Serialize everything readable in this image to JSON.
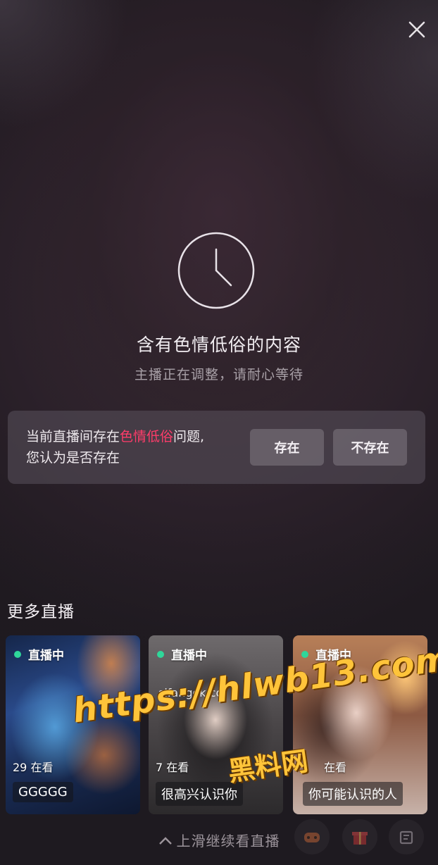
{
  "header": {
    "close_icon": "close-icon"
  },
  "notice": {
    "icon": "clock-icon",
    "title": "含有色情低俗的内容",
    "subtitle": "主播正在调整，请耐心等待"
  },
  "question": {
    "text_before": "当前直播间存在",
    "text_highlight": "色情低俗",
    "text_after": "问题,",
    "text_line2": "您认为是否存在",
    "highlight_color": "#ff3c6a",
    "yes_label": "存在",
    "no_label": "不存在"
  },
  "more_live": {
    "title": "更多直播",
    "cards": [
      {
        "badge": "直播中",
        "viewers": "29 在看",
        "name": "GGGGG"
      },
      {
        "badge": "直播中",
        "viewers": "7 在看",
        "name": "很高兴认识你",
        "watermark": "sifangok.cc"
      },
      {
        "badge": "直播中",
        "viewers": "在看",
        "name": "你可能认识的人"
      }
    ],
    "live_dot_color": "#2fd79a"
  },
  "overlay": {
    "url": "https://hlwb13.com",
    "site_name": "黑料网",
    "color": "#ffc43a"
  },
  "footer": {
    "swipe_hint": "上滑继续看直播",
    "icons": [
      "game-icon",
      "gift-icon",
      "shop-icon"
    ]
  }
}
